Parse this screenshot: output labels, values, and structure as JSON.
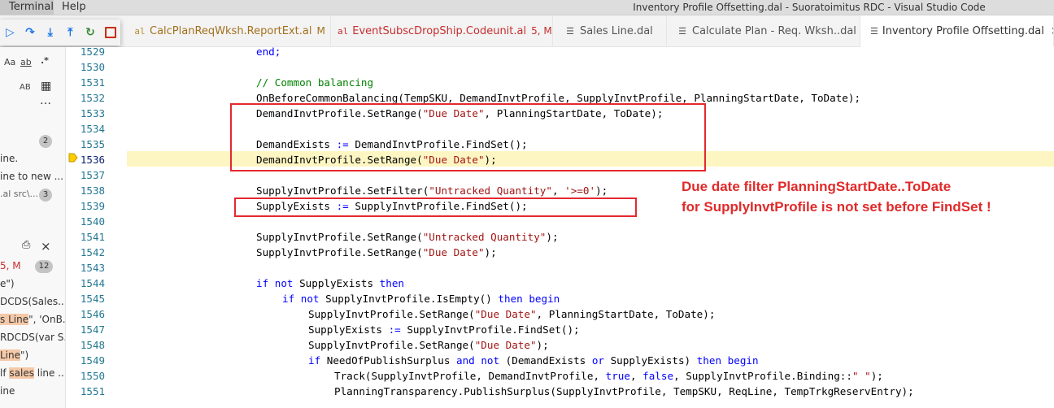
{
  "menu": {
    "terminal": "Terminal",
    "help": "Help"
  },
  "window_title": "Inventory Profile Offsetting.dal - Suoratoimitus RDC - Visual Studio Code",
  "tabs": [
    {
      "label": "CalcPlanReqWksh.ReportExt.al",
      "status": "M",
      "label_color": "#a3711c",
      "icon": "al-file-icon",
      "icon_color": "#b58b2e"
    },
    {
      "label": "EventSubscDropShip.Codeunit.al",
      "status": "5, M",
      "label_color": "#c72e2e",
      "icon": "al-file-icon",
      "icon_color": "#c72e2e",
      "dirty": true
    },
    {
      "label": "Sales Line.dal",
      "icon": "file-icon",
      "icon_color": "#555555"
    },
    {
      "label": "Calculate Plan - Req. Wksh..dal",
      "icon": "file-icon",
      "icon_color": "#555555"
    },
    {
      "label": "Inventory Profile Offsetting.dal",
      "icon": "file-icon",
      "icon_color": "#555555",
      "active": true,
      "close": "×"
    }
  ],
  "debug_toolbar": [
    {
      "name": "continue-icon",
      "glyph": "▷"
    },
    {
      "name": "step-over-icon",
      "glyph": "↷"
    },
    {
      "name": "step-into-icon",
      "glyph": "⤓"
    },
    {
      "name": "step-out-icon",
      "glyph": "⤒"
    },
    {
      "name": "restart-icon",
      "glyph": "↻"
    },
    {
      "name": "stop-icon",
      "glyph": ""
    }
  ],
  "sidebar": {
    "opt_case": "Aa",
    "opt_word": "ab",
    "opt_regex": ".*",
    "opt_preserve": "AB",
    "more": "…",
    "badge1": "2",
    "line1": "ine.",
    "line2": "ine to new ...",
    "line3": ".al src\\...",
    "badge3": "3",
    "close": "×",
    "line4": "5, M",
    "badge12": "12",
    "line5": "e\")",
    "line6": "DCDS(Sales...",
    "line7_hl": "s Line",
    "line7_rest": "\", 'OnB...",
    "line8": "RDCDS(var S...",
    "line9_hl": "Line",
    "line9_rest": "\")",
    "line10_pre": "lf ",
    "line10_hl": "sales",
    "line10_rest": " line ...",
    "line11": "ine"
  },
  "line_numbers": [
    "1529",
    "1530",
    "1531",
    "1532",
    "1533",
    "1534",
    "1535",
    "1536",
    "1537",
    "1538",
    "1539",
    "1540",
    "1541",
    "1542",
    "1543",
    "1544",
    "1545",
    "1546",
    "1547",
    "1548",
    "1549",
    "1550",
    "1551"
  ],
  "code": {
    "l1529": "end;",
    "l1531": "// Common balancing",
    "l1532": "OnBeforeCommonBalancing(TempSKU, DemandInvtProfile, SupplyInvtProfile, PlanningStartDate, ToDate);",
    "l1533_a": "DemandInvtProfile.SetRange(",
    "l1533_s": "\"Due Date\"",
    "l1533_b": ", PlanningStartDate, ToDate);",
    "l1535_a": "DemandExists ",
    "l1535_op": ":=",
    "l1535_b": " DemandInvtProfile.FindSet();",
    "l1536_a": "DemandInvtProfile.SetRange(",
    "l1536_s": "\"Due Date\"",
    "l1536_b": ");",
    "l1538_a": "SupplyInvtProfile.SetFilter(",
    "l1538_s": "\"Untracked Quantity\"",
    "l1538_c": ", ",
    "l1538_s2": "'>=0'",
    "l1538_b": ");",
    "l1539_a": "SupplyExists ",
    "l1539_op": ":=",
    "l1539_b": " SupplyInvtProfile.FindSet();",
    "l1541_a": "SupplyInvtProfile.SetRange(",
    "l1541_s": "\"Untracked Quantity\"",
    "l1541_b": ");",
    "l1542_a": "SupplyInvtProfile.SetRange(",
    "l1542_s": "\"Due Date\"",
    "l1542_b": ");",
    "l1544_k1": "if",
    "l1544_k2": "not",
    "l1544_a": " SupplyExists ",
    "l1544_k3": "then",
    "l1545_k1": "if",
    "l1545_k2": "not",
    "l1545_a": " SupplyInvtProfile.IsEmpty() ",
    "l1545_k3": "then",
    "l1545_k4": "begin",
    "l1546_a": "SupplyInvtProfile.SetRange(",
    "l1546_s": "\"Due Date\"",
    "l1546_b": ", PlanningStartDate, ToDate);",
    "l1547_a": "SupplyExists ",
    "l1547_op": ":=",
    "l1547_b": " SupplyInvtProfile.FindSet();",
    "l1548_a": "SupplyInvtProfile.SetRange(",
    "l1548_s": "\"Due Date\"",
    "l1548_b": ");",
    "l1549_k1": "if",
    "l1549_a": " NeedOfPublishSurplus ",
    "l1549_k2": "and",
    "l1549_k3": "not",
    "l1549_b": " (DemandExists ",
    "l1549_k4": "or",
    "l1549_c": " SupplyExists) ",
    "l1549_k5": "then",
    "l1549_k6": "begin",
    "l1550_a": "Track(SupplyInvtProfile, DemandInvtProfile, ",
    "l1550_k1": "true",
    "l1550_c": ", ",
    "l1550_k2": "false",
    "l1550_b": ", SupplyInvtProfile.Binding::",
    "l1550_s": "\" \"",
    "l1550_e": ");",
    "l1551": "PlanningTransparency.PublishSurplus(SupplyInvtProfile, TempSKU, ReqLine, TempTrkgReservEntry);"
  },
  "annotation": {
    "line1": "Due date filter PlanningStartDate..ToDate",
    "line2": "for SupplyInvtProfile is not set before FindSet !"
  },
  "colors": {
    "keyword": "#0000ff",
    "string": "#a31515",
    "comment": "#008000",
    "line_number": "#237893",
    "current_line": "#fdf6c3",
    "annotation_red": "#e02a2a"
  }
}
